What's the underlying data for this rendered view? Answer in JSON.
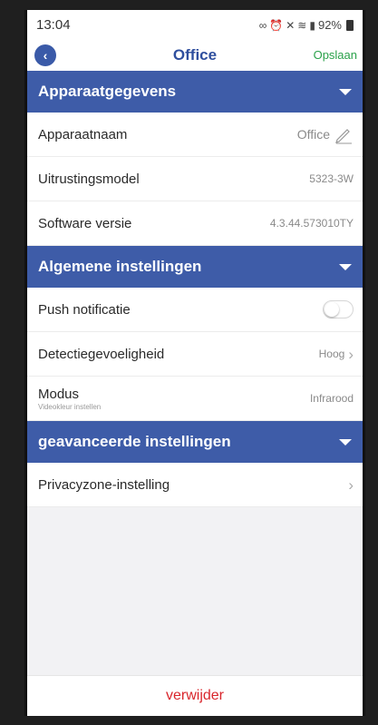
{
  "status": {
    "time": "13:04",
    "battery": "92%"
  },
  "nav": {
    "title": "Office",
    "save_label": "Opslaan"
  },
  "sections": {
    "device_info": {
      "title": "Apparaatgegevens",
      "rows": [
        {
          "label": "Apparaatnaam",
          "value": "Office"
        },
        {
          "label": "Uitrustingsmodel",
          "value": "5323-3W"
        },
        {
          "label": "Software versie",
          "value": "4.3.44.573010TY"
        }
      ]
    },
    "general": {
      "title": "Algemene instellingen",
      "push": {
        "label": "Push notificatie",
        "enabled": false
      },
      "sensitivity": {
        "label": "Detectiegevoeligheid",
        "value": "Hoog"
      },
      "mode": {
        "label": "Modus",
        "sub": "Videokleur instellen",
        "value": "Infrarood"
      }
    },
    "advanced": {
      "title": "geavanceerde instellingen",
      "privacy": {
        "label": "Privacyzone-instelling"
      }
    }
  },
  "footer": {
    "delete_label": "verwijder"
  },
  "colors": {
    "header": "#3e5ca8",
    "save": "#2aa14a",
    "delete": "#d9262c",
    "title": "#2f4f9e"
  }
}
